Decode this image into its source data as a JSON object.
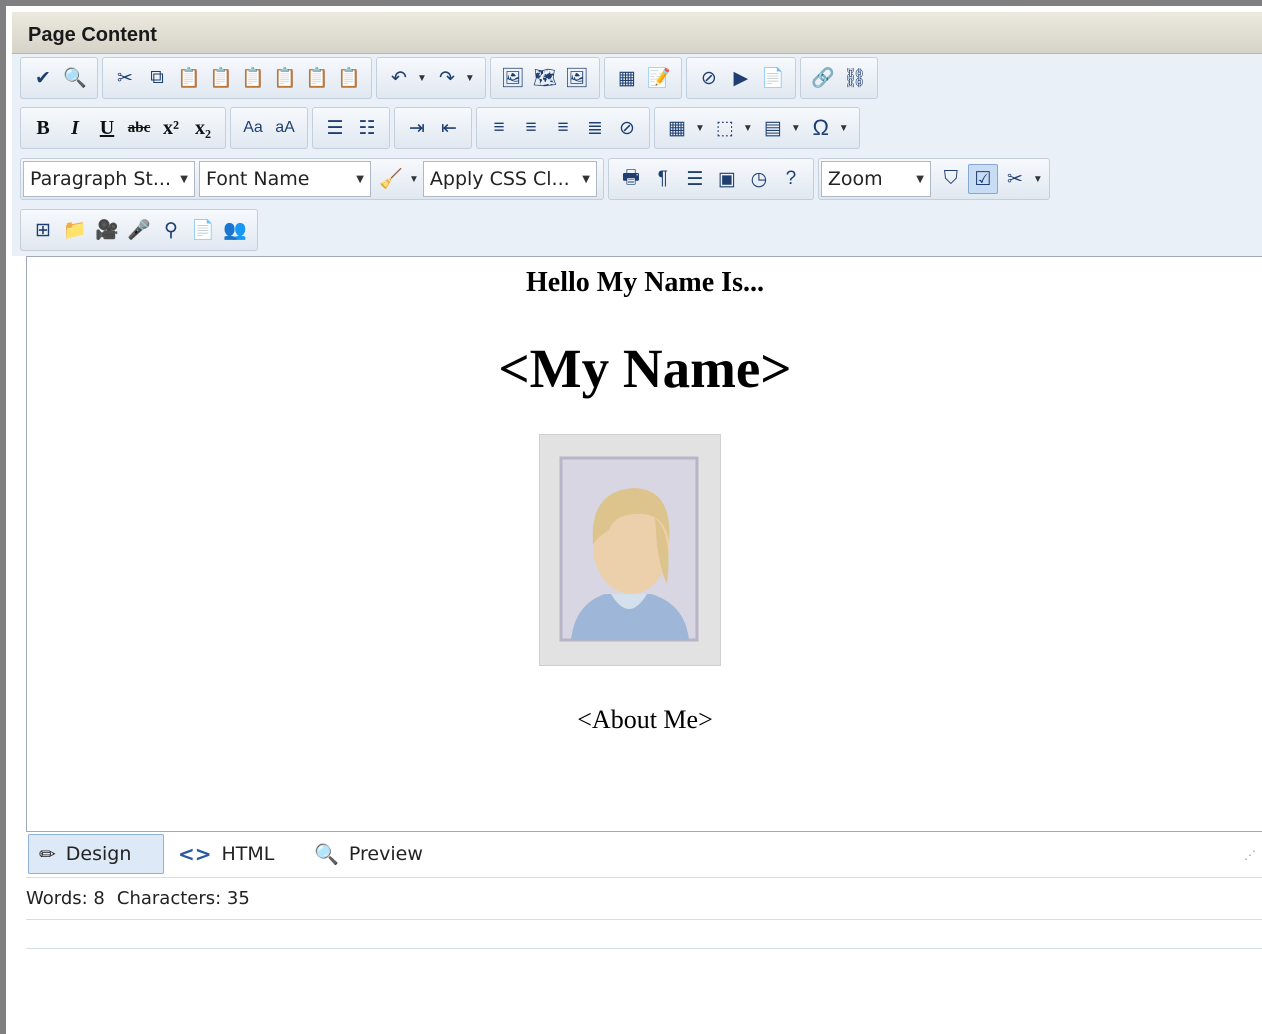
{
  "header": {
    "title": "Page Content"
  },
  "toolbar": {
    "paragraph_style": "Paragraph St...",
    "font_name": "Font Name",
    "css_class": "Apply CSS Cl...",
    "zoom": "Zoom"
  },
  "editor": {
    "heading": "Hello My Name Is...",
    "name": "<My Name>",
    "about": "<About Me>"
  },
  "modes": {
    "design": "Design",
    "html": "HTML",
    "preview": "Preview"
  },
  "status": {
    "words": "Words: 8",
    "characters": "Characters: 35"
  },
  "colors": {
    "toolbar_bg": "#eaf0f7",
    "active_tab": "#dde9f7",
    "header_bg": "#e0ddd3"
  }
}
